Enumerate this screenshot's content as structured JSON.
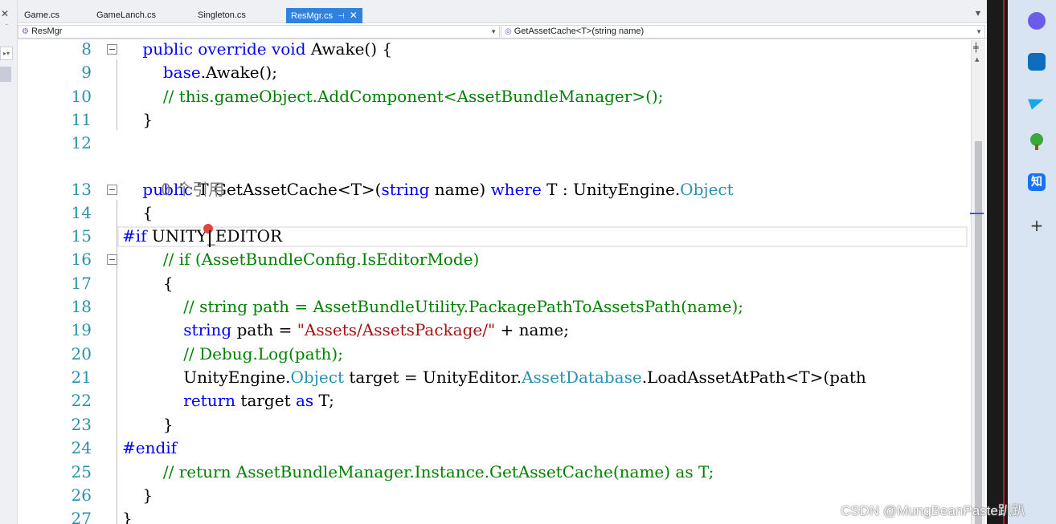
{
  "tabs": [
    {
      "label": "Game.cs",
      "active": false
    },
    {
      "label": "GameLanch.cs",
      "active": false
    },
    {
      "label": "Singleton.cs",
      "active": false
    },
    {
      "label": "ResMgr.cs",
      "active": true
    }
  ],
  "left_strip": {
    "close": "✕",
    "dots": "¨",
    "drop": "▸▾"
  },
  "nav": {
    "class_selector": "ResMgr",
    "member_selector": "GetAssetCache<T>(string name)"
  },
  "codelens": "0 个引用",
  "lines": [
    {
      "n": "8",
      "segments": [
        [
          "kw",
          "    public override void "
        ],
        [
          "pl",
          "Awake() {"
        ]
      ]
    },
    {
      "n": "9",
      "segments": [
        [
          "pl",
          "        "
        ],
        [
          "kw",
          "base"
        ],
        [
          "pl",
          ".Awake();"
        ]
      ]
    },
    {
      "n": "10",
      "segments": [
        [
          "cm",
          "        // this.gameObject.AddComponent<AssetBundleManager>();"
        ]
      ]
    },
    {
      "n": "11",
      "segments": [
        [
          "pl",
          "    }"
        ]
      ]
    },
    {
      "n": "12",
      "segments": [
        [
          "pl",
          ""
        ]
      ]
    },
    {
      "n": "13",
      "segments": [
        [
          "kw",
          "    public "
        ],
        [
          "pl",
          "T GetAssetCache<T>("
        ],
        [
          "kw",
          "string"
        ],
        [
          "pl",
          " name) "
        ],
        [
          "kw",
          "where"
        ],
        [
          "pl",
          " T : UnityEngine."
        ],
        [
          "ty",
          "Object"
        ]
      ]
    },
    {
      "n": "14",
      "segments": [
        [
          "pl",
          "    {"
        ]
      ]
    },
    {
      "n": "15",
      "segments": [
        [
          "pp",
          "#if"
        ],
        [
          "pl",
          " UNITY_EDITOR"
        ]
      ]
    },
    {
      "n": "16",
      "segments": [
        [
          "cm",
          "        // if (AssetBundleConfig.IsEditorMode)"
        ]
      ]
    },
    {
      "n": "17",
      "segments": [
        [
          "pl",
          "        {"
        ]
      ]
    },
    {
      "n": "18",
      "segments": [
        [
          "cm",
          "            // string path = AssetBundleUtility.PackagePathToAssetsPath(name);"
        ]
      ]
    },
    {
      "n": "19",
      "segments": [
        [
          "kw",
          "            string"
        ],
        [
          "pl",
          " path = "
        ],
        [
          "st",
          "\"Assets/AssetsPackage/\""
        ],
        [
          "pl",
          " + name;"
        ]
      ]
    },
    {
      "n": "20",
      "segments": [
        [
          "cm",
          "            // Debug.Log(path);"
        ]
      ]
    },
    {
      "n": "21",
      "segments": [
        [
          "pl",
          "            UnityEngine."
        ],
        [
          "ty",
          "Object"
        ],
        [
          "pl",
          " target = UnityEditor."
        ],
        [
          "ty",
          "AssetDatabase"
        ],
        [
          "pl",
          ".LoadAssetAtPath<T>(path"
        ]
      ]
    },
    {
      "n": "22",
      "segments": [
        [
          "kw",
          "            return"
        ],
        [
          "pl",
          " target "
        ],
        [
          "kw",
          "as"
        ],
        [
          "pl",
          " T;"
        ]
      ]
    },
    {
      "n": "23",
      "segments": [
        [
          "pl",
          "        }"
        ]
      ]
    },
    {
      "n": "24",
      "segments": [
        [
          "pp",
          "#endif"
        ]
      ]
    },
    {
      "n": "25",
      "segments": [
        [
          "cm",
          "        // return AssetBundleManager.Instance.GetAssetCache(name) as T;"
        ]
      ]
    },
    {
      "n": "26",
      "segments": [
        [
          "pl",
          "    }"
        ]
      ]
    },
    {
      "n": "27",
      "segments": [
        [
          "pl",
          "}"
        ]
      ]
    }
  ],
  "sidebar": {
    "zhihu": "知",
    "add": "+"
  },
  "watermark": "CSDN @MungBeanPaste趴趴"
}
